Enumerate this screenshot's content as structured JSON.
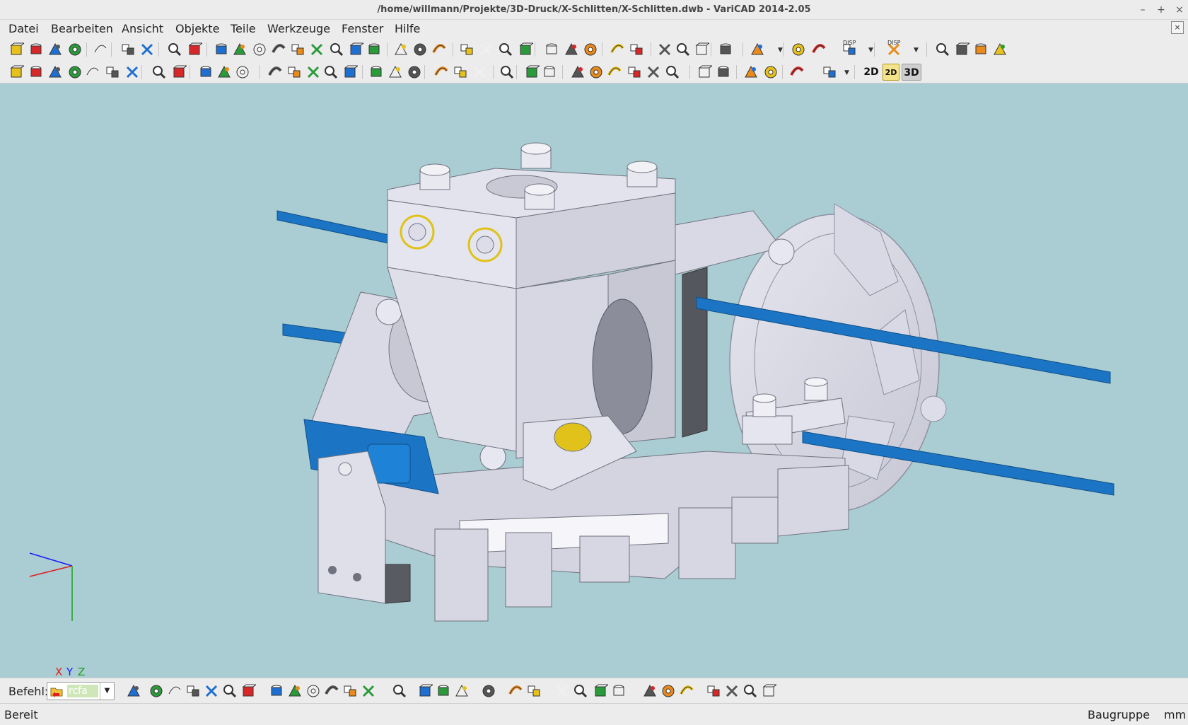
{
  "window": {
    "title": "/home/willmann/Projekte/3D-Druck/X-Schlitten/X-Schlitten.dwb - VariCAD 2014-2.05",
    "controls": [
      "–",
      "+",
      "×"
    ]
  },
  "menu": {
    "items": [
      "Datei",
      "Bearbeiten",
      "Ansicht",
      "Objekte",
      "Teile",
      "Werkzeuge",
      "Fenster",
      "Hilfe"
    ],
    "mdi_close": "×"
  },
  "toolbar1": {
    "icons": [
      "new-file-icon",
      "open-file-icon",
      "save-icon",
      "save-all-icon",
      "print-icon",
      "copy-icon",
      "paste-icon",
      "undo-icon",
      "redo-icon",
      "box-icon",
      "cylinder-icon",
      "prism-icon",
      "cone-icon",
      "ring-icon",
      "torus-icon",
      "pipe-icon",
      "bend-icon",
      "sphere-icon",
      "extrude-icon",
      "revolve-icon",
      "loft-icon",
      "cut-solid-icon",
      "drill-icon",
      "thread-icon",
      "fillet-icon",
      "chamfer-icon",
      "align-icon",
      "boolean-add-icon",
      "transform-icon",
      "move-icon",
      "info-icon",
      "query-icon",
      "check-icon",
      "edit-icon",
      "solid-view-icon",
      "zoom-window-icon",
      "zoom-previous-icon",
      "disp-icon",
      "disp2-icon",
      "zoom-all-icon",
      "zoom-out-icon",
      "zoom-in-icon",
      "zoom-fit-icon"
    ],
    "disp_label": "DISP"
  },
  "toolbar2": {
    "icons": [
      "delete-icon",
      "move-objects-icon",
      "align-objects-icon",
      "text-label-icon",
      "tag-icon",
      "rename-icon",
      "tools-icon",
      "solid-outline-icon",
      "solid-cube-icon",
      "dimension-icon",
      "percent-icon",
      "snap-icon",
      "pipe-yellow-icon",
      "cylinder-yellow-icon",
      "cutter-icon",
      "box-red-icon",
      "box-yellow-icon",
      "insert-part-icon",
      "explode-icon",
      "group-icon",
      "array-icon",
      "mirror-icon",
      "copy-array-icon",
      "layer-icon",
      "query-a-icon",
      "query-b-icon",
      "constraint-a-icon",
      "constraint-b-icon",
      "constraint-c-icon",
      "constraint-d-icon",
      "constraint-e-icon",
      "constraint-f-icon",
      "axis-a-icon",
      "axis-b-icon",
      "group-red-icon",
      "group-multi-icon",
      "group-delete-icon",
      "color-part-icon"
    ],
    "mode_2d": "2D",
    "mode_2d_icon": "2D",
    "mode_3d": "3D"
  },
  "viewport": {
    "axes": {
      "x_label": "X",
      "y_label": "Y",
      "z_label": "Z"
    },
    "background": "#a9cdd2",
    "part_color": "#dcdde8",
    "rod_color": "#1b75c4",
    "highlight_color": "#e0c21a"
  },
  "command": {
    "label": "Befehl:",
    "value": "rcfa"
  },
  "status": {
    "text": "Bereit",
    "mode": "Baugruppe",
    "unit": "mm"
  }
}
